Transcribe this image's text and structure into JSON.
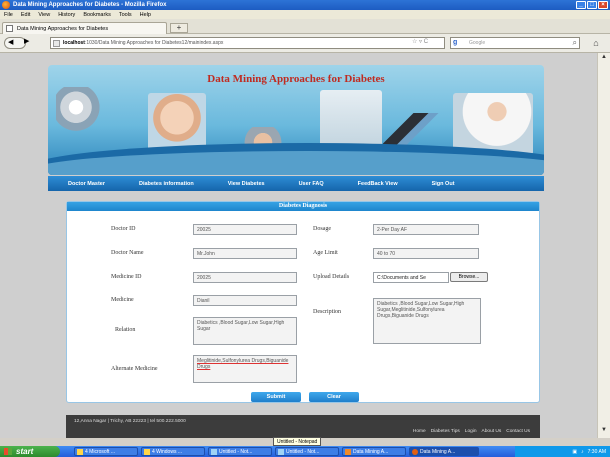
{
  "window": {
    "title": "Data Mining Approaches for Diabetes - Mozilla Firefox"
  },
  "menubar": [
    "File",
    "Edit",
    "View",
    "History",
    "Bookmarks",
    "Tools",
    "Help"
  ],
  "tab": {
    "label": "Data Mining Approaches for Diabetes",
    "new_tab": "+"
  },
  "url": {
    "host": "localhost",
    "path": ":1030/Data Mining Approaches for Diabetes12/mainindex.aspx"
  },
  "search": {
    "placeholder": "Google"
  },
  "banner": {
    "title": "Data Mining Approaches for Diabetes"
  },
  "nav": [
    "Doctor Master",
    "Diabetes information",
    "View Diabetes",
    "User FAQ",
    "FeedBack View",
    "Sign Out"
  ],
  "form": {
    "heading": "Diabetes Diagnosis",
    "doctor_id": {
      "label": "Doctor ID",
      "value": "20025"
    },
    "doctor_name": {
      "label": "Doctor Name",
      "value": "Mr.John"
    },
    "medicine_id": {
      "label": "Medicine ID",
      "value": "20025"
    },
    "medicine": {
      "label": "Medicine",
      "value": "Dianil"
    },
    "relation": {
      "label": "Relation",
      "value": "Diabetics ,Blood Sugar,Low Sugar,High Sugar"
    },
    "alternate_medicine": {
      "label": "Alternate Medicine",
      "value": "Meglitinide,Sulfonylurea Drugs,Biguanide Drugs"
    },
    "dosage": {
      "label": "Dosage",
      "value": "2-Per Day AF"
    },
    "age_limit": {
      "label": "Age Limit",
      "value": "40 to 70"
    },
    "upload": {
      "label": "Upload Details",
      "value": "C:\\Documents and Se",
      "browse": "Browse..."
    },
    "description": {
      "label": "Description",
      "value": "Diabetics ,Blood Sugar,Low Sugar,High Sugar,Meglitinide,Sulfonylurea Drugs,Biguanide Drugs"
    },
    "submit": "Submit",
    "clear": "Clear"
  },
  "footer": {
    "address": "12,Anna Nagar | Trichy, AB 22223 | tel 500.222.5000",
    "links": [
      "Home",
      "Diabetes Tips",
      "Login",
      "About Us",
      "Contact Us"
    ]
  },
  "tooltip": "Untitled - Notepad",
  "taskbar": {
    "start": "start",
    "items": [
      "4 Microsoft ...",
      "4 Windows ...",
      "Untitled - Not...",
      "Untitled - Not...",
      "Data Mining A...",
      "Data Mining A..."
    ],
    "clock": "7:30 AM"
  }
}
